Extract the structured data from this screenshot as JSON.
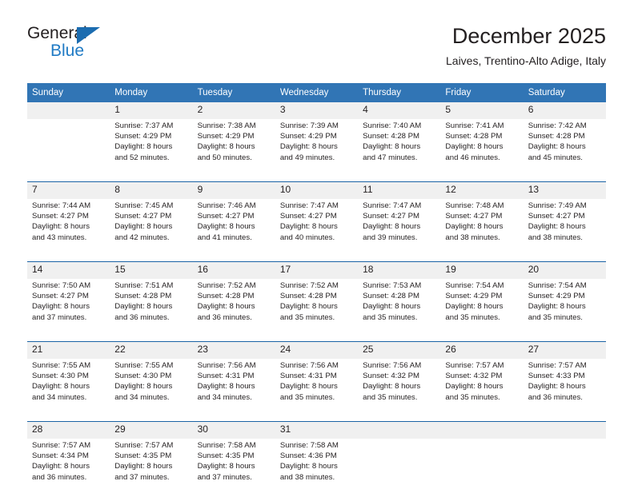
{
  "brand": {
    "name_part1": "General",
    "name_part2": "Blue",
    "triangle_color": "#1b6cb0",
    "blue_color": "#1f7ac4"
  },
  "header": {
    "title": "December 2025",
    "subtitle": "Laives, Trentino-Alto Adige, Italy"
  },
  "theme": {
    "header_bg": "#3175b5",
    "header_text": "#ffffff",
    "week_separator": "#1b63a5",
    "daynum_band": "#f0f0f0",
    "body_text": "#231f20"
  },
  "calendar": {
    "weekday_headers": [
      "Sunday",
      "Monday",
      "Tuesday",
      "Wednesday",
      "Thursday",
      "Friday",
      "Saturday"
    ],
    "weeks": [
      {
        "days": [
          {
            "num": "",
            "sunrise": "",
            "sunset": "",
            "daylight_1": "",
            "daylight_2": ""
          },
          {
            "num": "1",
            "sunrise": "Sunrise: 7:37 AM",
            "sunset": "Sunset: 4:29 PM",
            "daylight_1": "Daylight: 8 hours",
            "daylight_2": "and 52 minutes."
          },
          {
            "num": "2",
            "sunrise": "Sunrise: 7:38 AM",
            "sunset": "Sunset: 4:29 PM",
            "daylight_1": "Daylight: 8 hours",
            "daylight_2": "and 50 minutes."
          },
          {
            "num": "3",
            "sunrise": "Sunrise: 7:39 AM",
            "sunset": "Sunset: 4:29 PM",
            "daylight_1": "Daylight: 8 hours",
            "daylight_2": "and 49 minutes."
          },
          {
            "num": "4",
            "sunrise": "Sunrise: 7:40 AM",
            "sunset": "Sunset: 4:28 PM",
            "daylight_1": "Daylight: 8 hours",
            "daylight_2": "and 47 minutes."
          },
          {
            "num": "5",
            "sunrise": "Sunrise: 7:41 AM",
            "sunset": "Sunset: 4:28 PM",
            "daylight_1": "Daylight: 8 hours",
            "daylight_2": "and 46 minutes."
          },
          {
            "num": "6",
            "sunrise": "Sunrise: 7:42 AM",
            "sunset": "Sunset: 4:28 PM",
            "daylight_1": "Daylight: 8 hours",
            "daylight_2": "and 45 minutes."
          }
        ]
      },
      {
        "days": [
          {
            "num": "7",
            "sunrise": "Sunrise: 7:44 AM",
            "sunset": "Sunset: 4:27 PM",
            "daylight_1": "Daylight: 8 hours",
            "daylight_2": "and 43 minutes."
          },
          {
            "num": "8",
            "sunrise": "Sunrise: 7:45 AM",
            "sunset": "Sunset: 4:27 PM",
            "daylight_1": "Daylight: 8 hours",
            "daylight_2": "and 42 minutes."
          },
          {
            "num": "9",
            "sunrise": "Sunrise: 7:46 AM",
            "sunset": "Sunset: 4:27 PM",
            "daylight_1": "Daylight: 8 hours",
            "daylight_2": "and 41 minutes."
          },
          {
            "num": "10",
            "sunrise": "Sunrise: 7:47 AM",
            "sunset": "Sunset: 4:27 PM",
            "daylight_1": "Daylight: 8 hours",
            "daylight_2": "and 40 minutes."
          },
          {
            "num": "11",
            "sunrise": "Sunrise: 7:47 AM",
            "sunset": "Sunset: 4:27 PM",
            "daylight_1": "Daylight: 8 hours",
            "daylight_2": "and 39 minutes."
          },
          {
            "num": "12",
            "sunrise": "Sunrise: 7:48 AM",
            "sunset": "Sunset: 4:27 PM",
            "daylight_1": "Daylight: 8 hours",
            "daylight_2": "and 38 minutes."
          },
          {
            "num": "13",
            "sunrise": "Sunrise: 7:49 AM",
            "sunset": "Sunset: 4:27 PM",
            "daylight_1": "Daylight: 8 hours",
            "daylight_2": "and 38 minutes."
          }
        ]
      },
      {
        "days": [
          {
            "num": "14",
            "sunrise": "Sunrise: 7:50 AM",
            "sunset": "Sunset: 4:27 PM",
            "daylight_1": "Daylight: 8 hours",
            "daylight_2": "and 37 minutes."
          },
          {
            "num": "15",
            "sunrise": "Sunrise: 7:51 AM",
            "sunset": "Sunset: 4:28 PM",
            "daylight_1": "Daylight: 8 hours",
            "daylight_2": "and 36 minutes."
          },
          {
            "num": "16",
            "sunrise": "Sunrise: 7:52 AM",
            "sunset": "Sunset: 4:28 PM",
            "daylight_1": "Daylight: 8 hours",
            "daylight_2": "and 36 minutes."
          },
          {
            "num": "17",
            "sunrise": "Sunrise: 7:52 AM",
            "sunset": "Sunset: 4:28 PM",
            "daylight_1": "Daylight: 8 hours",
            "daylight_2": "and 35 minutes."
          },
          {
            "num": "18",
            "sunrise": "Sunrise: 7:53 AM",
            "sunset": "Sunset: 4:28 PM",
            "daylight_1": "Daylight: 8 hours",
            "daylight_2": "and 35 minutes."
          },
          {
            "num": "19",
            "sunrise": "Sunrise: 7:54 AM",
            "sunset": "Sunset: 4:29 PM",
            "daylight_1": "Daylight: 8 hours",
            "daylight_2": "and 35 minutes."
          },
          {
            "num": "20",
            "sunrise": "Sunrise: 7:54 AM",
            "sunset": "Sunset: 4:29 PM",
            "daylight_1": "Daylight: 8 hours",
            "daylight_2": "and 35 minutes."
          }
        ]
      },
      {
        "days": [
          {
            "num": "21",
            "sunrise": "Sunrise: 7:55 AM",
            "sunset": "Sunset: 4:30 PM",
            "daylight_1": "Daylight: 8 hours",
            "daylight_2": "and 34 minutes."
          },
          {
            "num": "22",
            "sunrise": "Sunrise: 7:55 AM",
            "sunset": "Sunset: 4:30 PM",
            "daylight_1": "Daylight: 8 hours",
            "daylight_2": "and 34 minutes."
          },
          {
            "num": "23",
            "sunrise": "Sunrise: 7:56 AM",
            "sunset": "Sunset: 4:31 PM",
            "daylight_1": "Daylight: 8 hours",
            "daylight_2": "and 34 minutes."
          },
          {
            "num": "24",
            "sunrise": "Sunrise: 7:56 AM",
            "sunset": "Sunset: 4:31 PM",
            "daylight_1": "Daylight: 8 hours",
            "daylight_2": "and 35 minutes."
          },
          {
            "num": "25",
            "sunrise": "Sunrise: 7:56 AM",
            "sunset": "Sunset: 4:32 PM",
            "daylight_1": "Daylight: 8 hours",
            "daylight_2": "and 35 minutes."
          },
          {
            "num": "26",
            "sunrise": "Sunrise: 7:57 AM",
            "sunset": "Sunset: 4:32 PM",
            "daylight_1": "Daylight: 8 hours",
            "daylight_2": "and 35 minutes."
          },
          {
            "num": "27",
            "sunrise": "Sunrise: 7:57 AM",
            "sunset": "Sunset: 4:33 PM",
            "daylight_1": "Daylight: 8 hours",
            "daylight_2": "and 36 minutes."
          }
        ]
      },
      {
        "days": [
          {
            "num": "28",
            "sunrise": "Sunrise: 7:57 AM",
            "sunset": "Sunset: 4:34 PM",
            "daylight_1": "Daylight: 8 hours",
            "daylight_2": "and 36 minutes."
          },
          {
            "num": "29",
            "sunrise": "Sunrise: 7:57 AM",
            "sunset": "Sunset: 4:35 PM",
            "daylight_1": "Daylight: 8 hours",
            "daylight_2": "and 37 minutes."
          },
          {
            "num": "30",
            "sunrise": "Sunrise: 7:58 AM",
            "sunset": "Sunset: 4:35 PM",
            "daylight_1": "Daylight: 8 hours",
            "daylight_2": "and 37 minutes."
          },
          {
            "num": "31",
            "sunrise": "Sunrise: 7:58 AM",
            "sunset": "Sunset: 4:36 PM",
            "daylight_1": "Daylight: 8 hours",
            "daylight_2": "and 38 minutes."
          },
          {
            "num": "",
            "sunrise": "",
            "sunset": "",
            "daylight_1": "",
            "daylight_2": ""
          },
          {
            "num": "",
            "sunrise": "",
            "sunset": "",
            "daylight_1": "",
            "daylight_2": ""
          },
          {
            "num": "",
            "sunrise": "",
            "sunset": "",
            "daylight_1": "",
            "daylight_2": ""
          }
        ]
      }
    ]
  }
}
